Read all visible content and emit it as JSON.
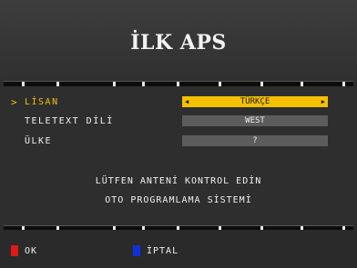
{
  "title": "İLK APS",
  "menu": [
    {
      "label": "LİSAN",
      "value": "TÜRKÇE",
      "active": true
    },
    {
      "label": "TELETEXT DİLİ",
      "value": "WEST",
      "active": false
    },
    {
      "label": "ÜLKE",
      "value": "?",
      "active": false
    }
  ],
  "cursor_glyph": ">",
  "arrows": {
    "left": "◀",
    "right": "▶"
  },
  "messages": [
    "LÜTFEN ANTENİ KONTROL EDİN",
    "OTO PROGRAMLAMA SİSTEMİ"
  ],
  "footer": {
    "ok_label": "OK",
    "cancel_label": "İPTAL"
  },
  "colors": {
    "highlight": "#f5c000",
    "ok_key": "#e01818",
    "cancel_key": "#1030e0"
  }
}
